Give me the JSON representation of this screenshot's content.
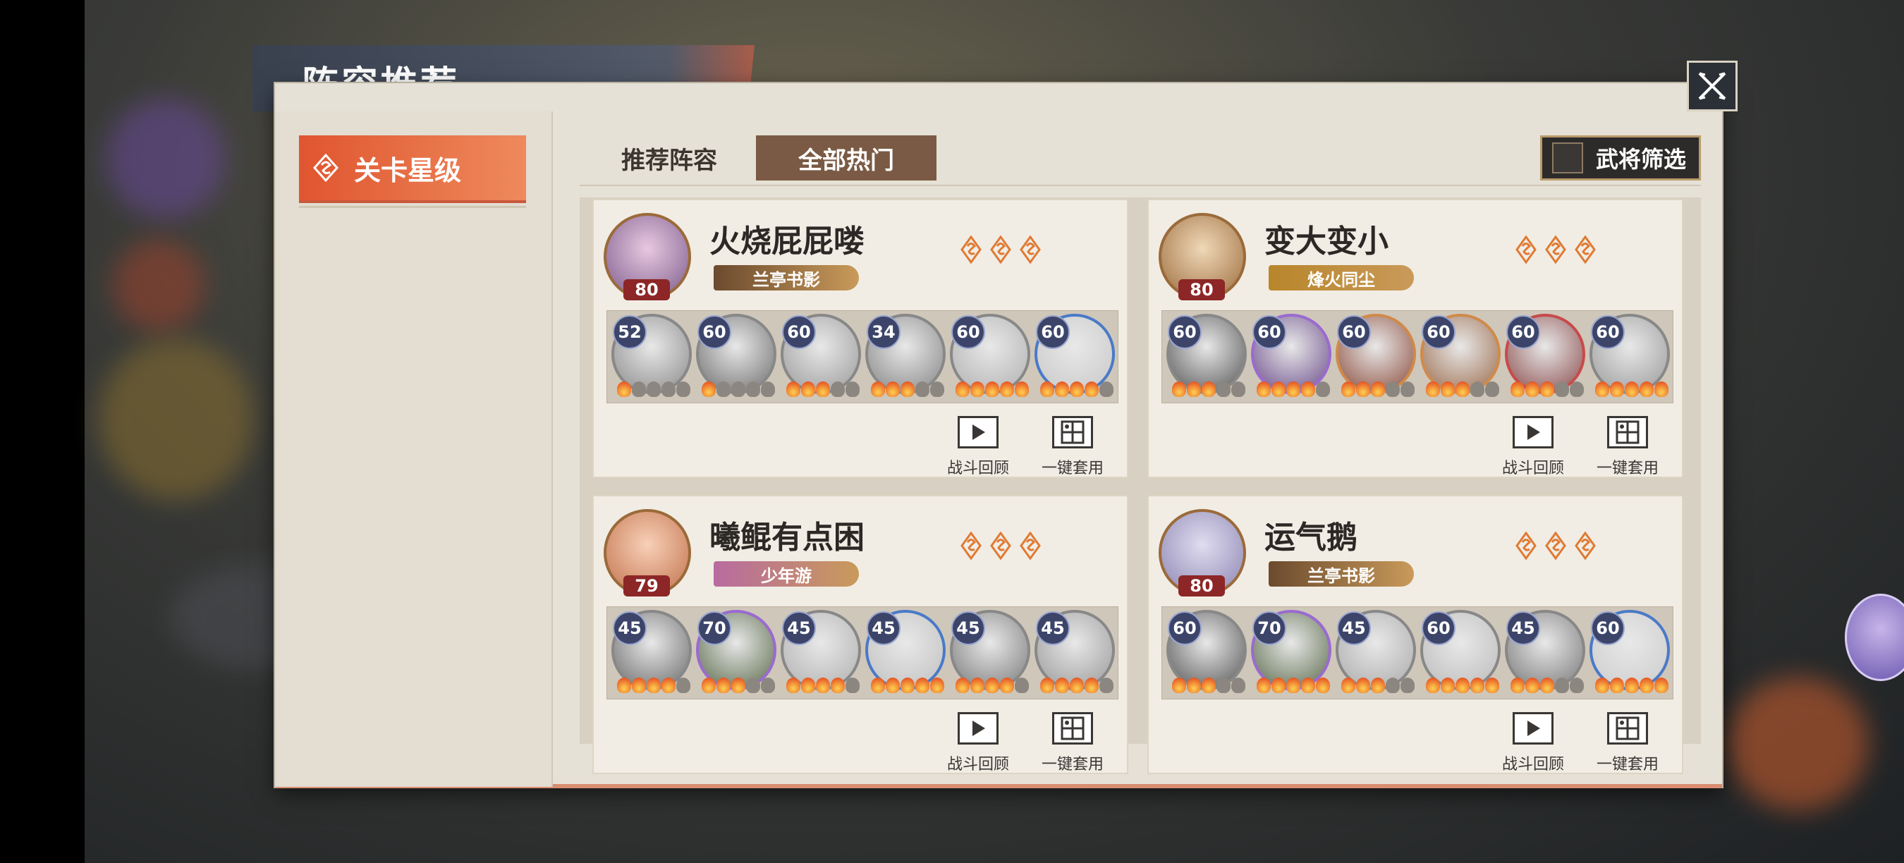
{
  "title": "阵容推荐",
  "sidebar": {
    "items": [
      {
        "label": "关卡星级"
      }
    ]
  },
  "tabs": [
    {
      "label": "推荐阵容",
      "active": false
    },
    {
      "label": "全部热门",
      "active": true
    }
  ],
  "filter": {
    "label": "武将筛选"
  },
  "actions": {
    "replay": "战斗回顾",
    "apply": "一键套用"
  },
  "cards": [
    {
      "name": "火烧屁屁喽",
      "level": "80",
      "tag": "兰亭书影",
      "tag_color": "#6b4a2e",
      "heroes": [
        {
          "level": "52",
          "fire": 1
        },
        {
          "level": "60",
          "fire": 1
        },
        {
          "level": "60",
          "fire": 3
        },
        {
          "level": "34",
          "fire": 3
        },
        {
          "level": "60",
          "fire": 5
        },
        {
          "level": "60",
          "fire": 4
        }
      ]
    },
    {
      "name": "变大变小",
      "level": "80",
      "tag": "烽火同尘",
      "tag_color": "#b8862a",
      "heroes": [
        {
          "level": "60",
          "fire": 3
        },
        {
          "level": "60",
          "fire": 4
        },
        {
          "level": "60",
          "fire": 3
        },
        {
          "level": "60",
          "fire": 3
        },
        {
          "level": "60",
          "fire": 3
        },
        {
          "level": "60",
          "fire": 5
        }
      ]
    },
    {
      "name": "曦鲲有点困",
      "level": "79",
      "tag": "少年游",
      "tag_color": "#b86ba0",
      "heroes": [
        {
          "level": "45",
          "fire": 4
        },
        {
          "level": "70",
          "fire": 3
        },
        {
          "level": "45",
          "fire": 4
        },
        {
          "level": "45",
          "fire": 5
        },
        {
          "level": "45",
          "fire": 4
        },
        {
          "level": "45",
          "fire": 4
        }
      ]
    },
    {
      "name": "运气鹅",
      "level": "80",
      "tag": "兰亭书影",
      "tag_color": "#6b4a2e",
      "heroes": [
        {
          "level": "60",
          "fire": 3
        },
        {
          "level": "70",
          "fire": 5
        },
        {
          "level": "45",
          "fire": 3
        },
        {
          "level": "60",
          "fire": 5
        },
        {
          "level": "45",
          "fire": 3
        },
        {
          "level": "60",
          "fire": 5
        }
      ]
    }
  ]
}
